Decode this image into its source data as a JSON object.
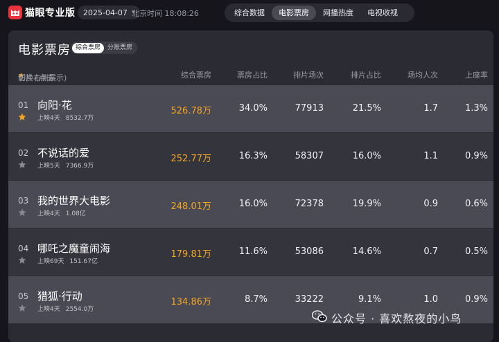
{
  "app": {
    "name": "猫眼专业版"
  },
  "topbar": {
    "date": "2025-04-07",
    "clock": "北京时间 18:08:26",
    "nav": [
      {
        "label": "综合数据",
        "active": false
      },
      {
        "label": "电影票房",
        "active": true
      },
      {
        "label": "网播热度",
        "active": false
      },
      {
        "label": "电视收视",
        "active": false
      }
    ]
  },
  "panel": {
    "title": "电影票房",
    "tabs": [
      {
        "label": "综合票房",
        "active": true
      },
      {
        "label": "分账票房",
        "active": false
      }
    ],
    "columns": {
      "film_prefix": "影片 (点击",
      "film_suffix": "切换右侧展示)",
      "box": "综合票房",
      "box_share": "票房占比",
      "screenings": "排片场次",
      "screen_share": "排片占比",
      "avg_people": "场均人次",
      "occupancy": "上座率"
    },
    "rows": [
      {
        "rank": "01",
        "name": "向阳·花",
        "days": "上映4天",
        "total": "8532.7万",
        "box": "526.78万",
        "box_share": "34.0%",
        "screenings": "77913",
        "screen_share": "21.5%",
        "avg_people": "1.7",
        "occupancy": "1.3%",
        "starred": true
      },
      {
        "rank": "02",
        "name": "不说话的爱",
        "days": "上映5天",
        "total": "7366.9万",
        "box": "252.77万",
        "box_share": "16.3%",
        "screenings": "58307",
        "screen_share": "16.0%",
        "avg_people": "1.1",
        "occupancy": "0.9%",
        "starred": false
      },
      {
        "rank": "03",
        "name": "我的世界大电影",
        "days": "上映4天",
        "total": "1.08亿",
        "box": "248.01万",
        "box_share": "16.0%",
        "screenings": "72378",
        "screen_share": "19.9%",
        "avg_people": "0.9",
        "occupancy": "0.6%",
        "starred": false
      },
      {
        "rank": "04",
        "name": "哪吒之魔童闹海",
        "days": "上映69天",
        "total": "151.67亿",
        "box": "179.81万",
        "box_share": "11.6%",
        "screenings": "53086",
        "screen_share": "14.6%",
        "avg_people": "0.7",
        "occupancy": "0.5%",
        "starred": false
      },
      {
        "rank": "05",
        "name": "猎狐·行动",
        "days": "上映4天",
        "total": "2554.0万",
        "box": "134.86万",
        "box_share": "8.7%",
        "screenings": "33222",
        "screen_share": "9.1%",
        "avg_people": "1.0",
        "occupancy": "0.9%",
        "starred": false
      }
    ]
  },
  "watermark": {
    "text": "公众号 · 喜欢熬夜的小鸟"
  },
  "colors": {
    "accent": "#f5a623",
    "brand": "#e8323c",
    "row_light": "#4a4a55",
    "row_dark": "#34343d",
    "panel": "#2b2b33"
  }
}
